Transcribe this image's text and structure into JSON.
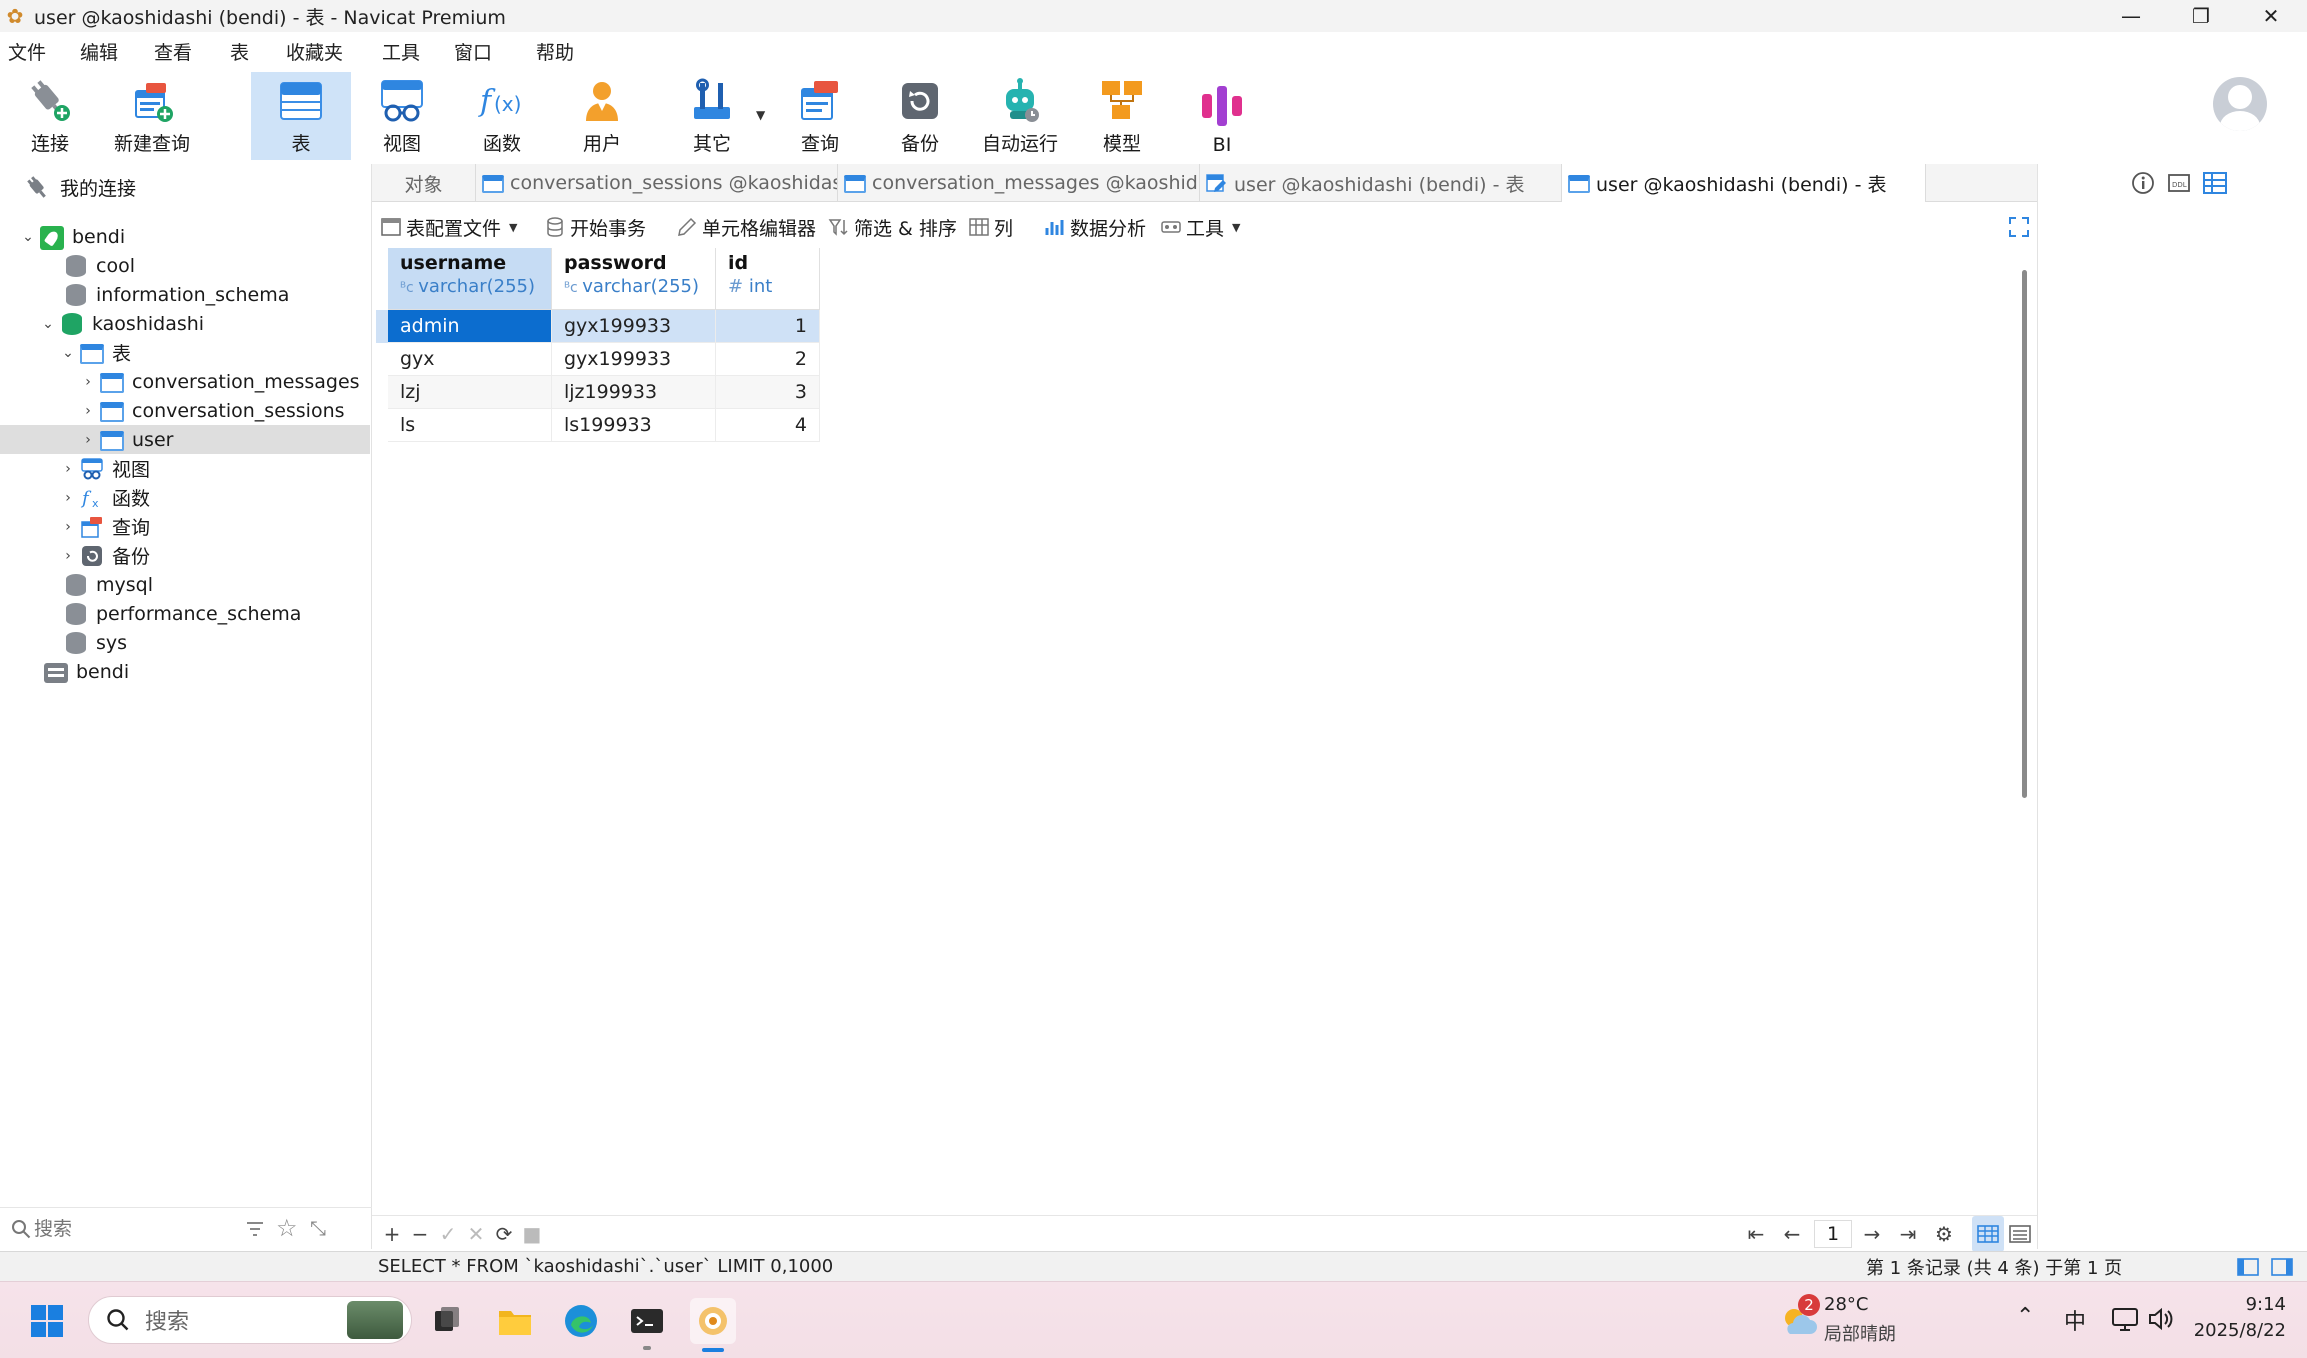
{
  "window": {
    "title": "user @kaoshidashi (bendi) - 表 - Navicat Premium"
  },
  "menu": [
    "文件",
    "编辑",
    "查看",
    "表",
    "收藏夹",
    "工具",
    "窗口",
    "帮助"
  ],
  "toolbar": {
    "connect": "连接",
    "new_query": "新建查询",
    "table": "表",
    "view": "视图",
    "function": "函数",
    "user": "用户",
    "other": "其它",
    "query": "查询",
    "backup": "备份",
    "automation": "自动运行",
    "model": "模型",
    "bi": "BI"
  },
  "sidebar": {
    "header": "我的连接",
    "tree": {
      "conn": "bendi",
      "cool": "cool",
      "information_schema": "information_schema",
      "kaoshidashi": "kaoshidashi",
      "tables": "表",
      "t1": "conversation_messages",
      "t2": "conversation_sessions",
      "t3": "user",
      "views": "视图",
      "functions": "函数",
      "queries": "查询",
      "backups": "备份",
      "mysql": "mysql",
      "performance_schema": "performance_schema",
      "sys": "sys",
      "server": "bendi"
    },
    "search_placeholder": "搜索"
  },
  "tabs": {
    "objects": "对象",
    "t1": "conversation_sessions @kaoshidashi...",
    "t2": "conversation_messages @kaoshidas...",
    "t3": "user @kaoshidashi (bendi) - 表",
    "t4": "user @kaoshidashi (bendi) - 表"
  },
  "subtoolbar": {
    "profile": "表配置文件",
    "transaction": "开始事务",
    "cell_editor": "单元格编辑器",
    "filter_sort": "筛选 & 排序",
    "columns": "列",
    "analysis": "数据分析",
    "tools": "工具"
  },
  "grid": {
    "columns": [
      {
        "name": "username",
        "type": "varchar(255)"
      },
      {
        "name": "password",
        "type": "varchar(255)"
      },
      {
        "name": "id",
        "type": "int"
      }
    ],
    "rows": [
      [
        "admin",
        "gyx199933",
        "1"
      ],
      [
        "gyx",
        "gyx199933",
        "2"
      ],
      [
        "lzj",
        "ljz199933",
        "3"
      ],
      [
        "ls",
        "ls199933",
        "4"
      ]
    ]
  },
  "pager": {
    "page": "1"
  },
  "status": {
    "sql": "SELECT * FROM `kaoshidashi`.`user` LIMIT 0,1000",
    "records": "第 1 条记录 (共 4 条) 于第 1 页"
  },
  "taskbar": {
    "search_placeholder": "搜索",
    "weather_badge": "2",
    "temp": "28°C",
    "weather": "局部晴朗",
    "ime": "中",
    "time": "9:14",
    "date": "2025/8/22"
  },
  "colors": {
    "accent": "#0c6dcf",
    "selection": "#cfe1f6",
    "toolbar_active": "#cfe3f8"
  }
}
